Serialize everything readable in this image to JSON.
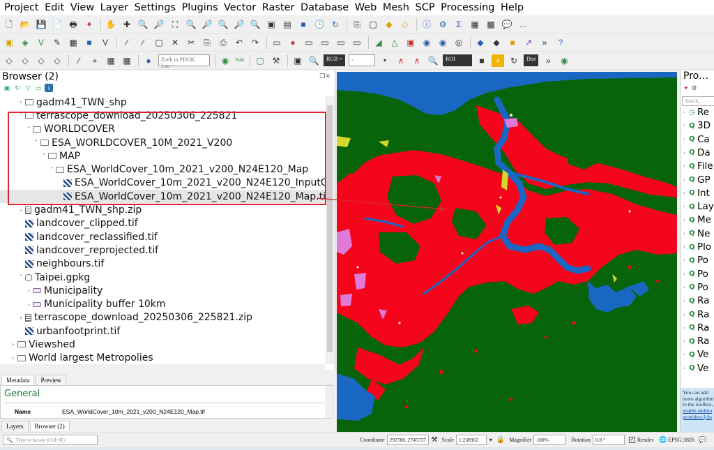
{
  "menubar": [
    "Project",
    "Edit",
    "View",
    "Layer",
    "Settings",
    "Plugins",
    "Vector",
    "Raster",
    "Database",
    "Web",
    "Mesh",
    "SCP",
    "Processing",
    "Help"
  ],
  "toolbar": {
    "zoom_placeholder": "Zoek in PDOK Loc···",
    "rgb_label": "RGB =",
    "rgb_value": "-",
    "roi_label": "ROI",
    "dist_label": "Dist",
    "hub_label": "hub"
  },
  "browser": {
    "title": "Browser (2)",
    "items": [
      {
        "label": "gadm41_TWN_shp",
        "level": 1,
        "arrow": "›",
        "icon": "folder"
      },
      {
        "label": "terrascope_download_20250306_225821",
        "level": 1,
        "arrow": "˅",
        "icon": "folder"
      },
      {
        "label": "WORLDCOVER",
        "level": 2,
        "arrow": "˅",
        "icon": "folder"
      },
      {
        "label": "ESA_WORLDCOVER_10M_2021_V200",
        "level": 3,
        "arrow": "˅",
        "icon": "folder"
      },
      {
        "label": "MAP",
        "level": 4,
        "arrow": "˅",
        "icon": "folder"
      },
      {
        "label": "ESA_WorldCover_10m_2021_v200_N24E120_Map",
        "level": 5,
        "arrow": "˅",
        "icon": "folder"
      },
      {
        "label": "ESA_WorldCover_10m_2021_v200_N24E120_InputQualit",
        "level": 6,
        "arrow": "",
        "icon": "raster"
      },
      {
        "label": "ESA_WorldCover_10m_2021_v200_N24E120_Map.tif",
        "level": 6,
        "arrow": "",
        "icon": "raster"
      },
      {
        "label": "gadm41_TWN_shp.zip",
        "level": 1,
        "arrow": "›",
        "icon": "zip"
      },
      {
        "label": "landcover_clipped.tif",
        "level": 1,
        "arrow": "",
        "icon": "raster"
      },
      {
        "label": "landcover_reclassified.tif",
        "level": 1,
        "arrow": "",
        "icon": "raster"
      },
      {
        "label": "landcover_reprojected.tif",
        "level": 1,
        "arrow": "",
        "icon": "raster"
      },
      {
        "label": "neighbours.tif",
        "level": 1,
        "arrow": "",
        "icon": "raster"
      },
      {
        "label": "Taipei.gpkg",
        "level": 1,
        "arrow": "˅",
        "icon": "gpkg"
      },
      {
        "label": "Municipality",
        "level": 2,
        "arrow": "›",
        "icon": "poly"
      },
      {
        "label": "Municipality buffer 10km",
        "level": 2,
        "arrow": "›",
        "icon": "poly"
      },
      {
        "label": "terrascope_download_20250306_225821.zip",
        "level": 1,
        "arrow": "›",
        "icon": "zip"
      },
      {
        "label": "urbanfootprint.tif",
        "level": 1,
        "arrow": "",
        "icon": "raster"
      },
      {
        "label": "Viewshed",
        "level": 0,
        "arrow": "›",
        "icon": "folder"
      },
      {
        "label": "World largest Metropolies",
        "level": 0,
        "arrow": "›",
        "icon": "folder"
      }
    ]
  },
  "metadata": {
    "tabs": [
      "Metadata",
      "Preview"
    ],
    "heading": "General",
    "name_key": "Name",
    "name_value": "ESA_WorldCover_10m_2021_v200_N24E120_Map.tif"
  },
  "bottom_tabs": [
    "Layers",
    "Browser (2)"
  ],
  "processing": {
    "title": "Pro…",
    "search_placeholder": "Search…",
    "items": [
      "Re",
      "3D",
      "Ca",
      "Da",
      "File",
      "GP",
      "Int",
      "Lay",
      "Me",
      "Ne",
      "Plo",
      "Po",
      "Po",
      "Po",
      "Ra",
      "Ra",
      "Ra",
      "Ra",
      "Ve",
      "Ve"
    ],
    "info_lines": [
      "You can add",
      "more algorithm",
      "to the toolbox,"
    ],
    "info_links": [
      "enable additio",
      "providers.[clo"
    ]
  },
  "statusbar": {
    "locate_placeholder": "Type to locate (Ctrl+K)",
    "coordinate_label": "Coordinate",
    "coordinate_value": "292780, 2745737",
    "scale_label": "Scale",
    "scale_value": "1:238962",
    "magnifier_label": "Magnifier",
    "magnifier_value": "100%",
    "rotation_label": "Rotation",
    "rotation_value": "0.0 °",
    "render_label": "Render",
    "crs_label": "EPSG:3826"
  },
  "colors": {
    "map_tree_cover": "#07640a",
    "map_built_up": "#f4051c",
    "map_water": "#1a67c3",
    "map_grass": "#d4d82b",
    "map_crop": "#e07ad8",
    "highlight": "#d6262f"
  }
}
